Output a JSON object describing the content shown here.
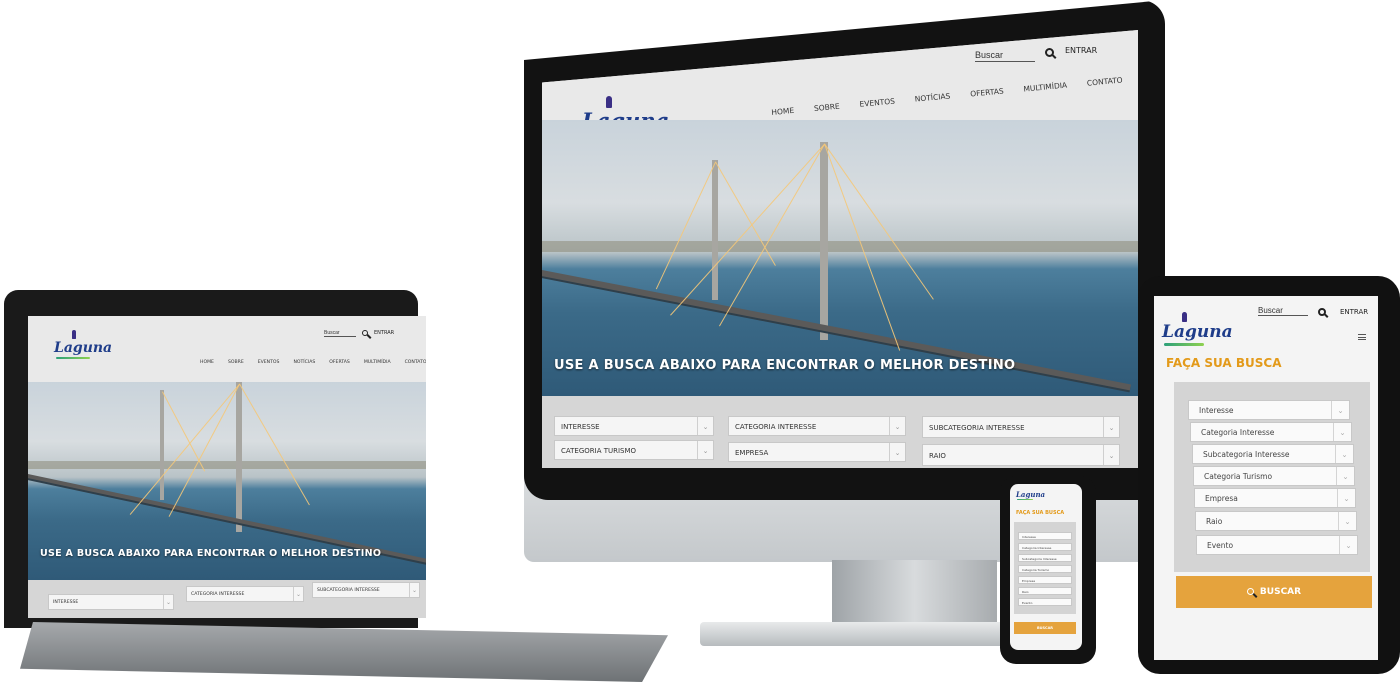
{
  "site": {
    "brand": "Laguna",
    "search_placeholder": "Buscar",
    "login_label": "ENTRAR",
    "nav": [
      "Home",
      "Sobre",
      "Eventos",
      "Notícias",
      "Ofertas",
      "Multimídia",
      "Contato"
    ],
    "hero_tagline": "USE A BUSCA ABAIXO PARA ENCONTRAR O MELHOR DESTINO",
    "filters_desktop": [
      "Interesse",
      "Categoria Interesse",
      "Subcategoria Interesse",
      "Categoria Turismo",
      "Empresa",
      "Raio"
    ],
    "mobile_title": "FAÇA SUA BUSCA",
    "filters_mobile": [
      "Interesse",
      "Categoria Interesse",
      "Subcategoria Interesse",
      "Categoria Turismo",
      "Empresa",
      "Raio",
      "Evento"
    ],
    "search_button": "BUSCAR"
  },
  "colors": {
    "accent": "#e5a33d",
    "title_orange": "#e39a1a",
    "brand_blue": "#1f3d8a",
    "brand_green": "#2ca07a"
  },
  "icons": {
    "search": "search-icon",
    "menu": "hamburger-menu-icon",
    "dropdown": "chevron-down-icon"
  }
}
